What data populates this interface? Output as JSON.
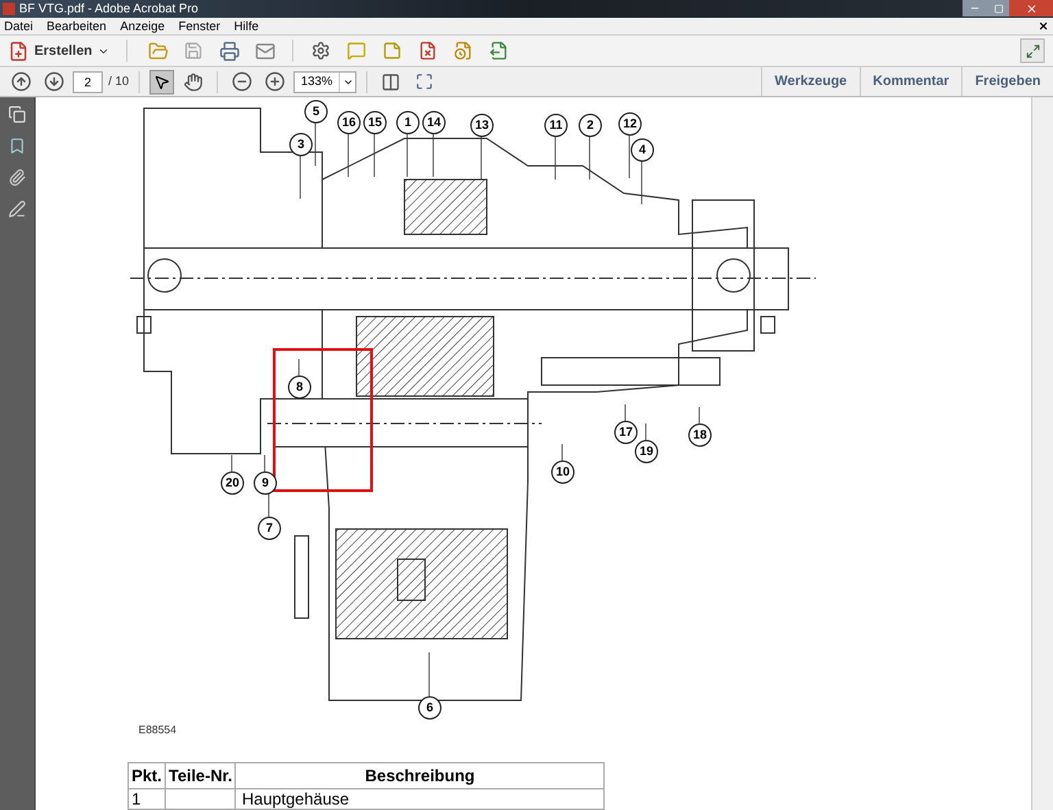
{
  "window": {
    "title": "BF VTG.pdf - Adobe Acrobat Pro"
  },
  "menu": [
    "Datei",
    "Bearbeiten",
    "Anzeige",
    "Fenster",
    "Hilfe"
  ],
  "toolbar": {
    "create_button": "Erstellen",
    "page_number": "2",
    "page_count": "/ 10",
    "zoom": "133%"
  },
  "panel_tabs": [
    {
      "label": "Werkzeuge"
    },
    {
      "label": "Kommentar"
    },
    {
      "label": "Freigeben"
    }
  ],
  "figure": {
    "callouts": [
      "5",
      "3",
      "16",
      "15",
      "1",
      "14",
      "13",
      "11",
      "2",
      "12",
      "4",
      "8",
      "9",
      "20",
      "7",
      "10",
      "17",
      "19",
      "18",
      "6"
    ],
    "figure_id": "E88554"
  },
  "table": {
    "columns": [
      "Pkt.",
      "Teile-Nr.",
      "Beschreibung"
    ],
    "rows": [
      {
        "number": "1",
        "description": "Hauptgehäuse"
      }
    ]
  }
}
